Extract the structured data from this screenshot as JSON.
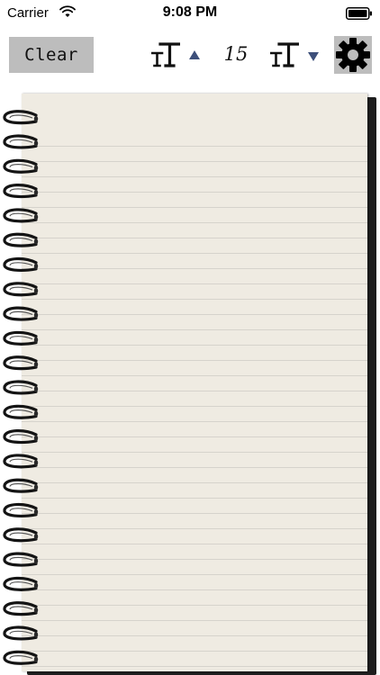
{
  "status_bar": {
    "carrier": "Carrier",
    "time": "9:08 PM",
    "wifi_icon": "wifi-icon",
    "battery_icon": "battery-icon"
  },
  "toolbar": {
    "clear_label": "Clear",
    "font_size": "15",
    "increase_icon": "font-size-increase-icon",
    "decrease_icon": "font-size-decrease-icon",
    "settings_icon": "gear-icon"
  },
  "notebook": {
    "text": ""
  },
  "colors": {
    "button_gray": "#bdbdbd",
    "page": "#efebe2",
    "rule_line": "#d6d3cc",
    "arrow_blue": "#3d4f7a",
    "notebook_back": "#1e1e1e"
  }
}
